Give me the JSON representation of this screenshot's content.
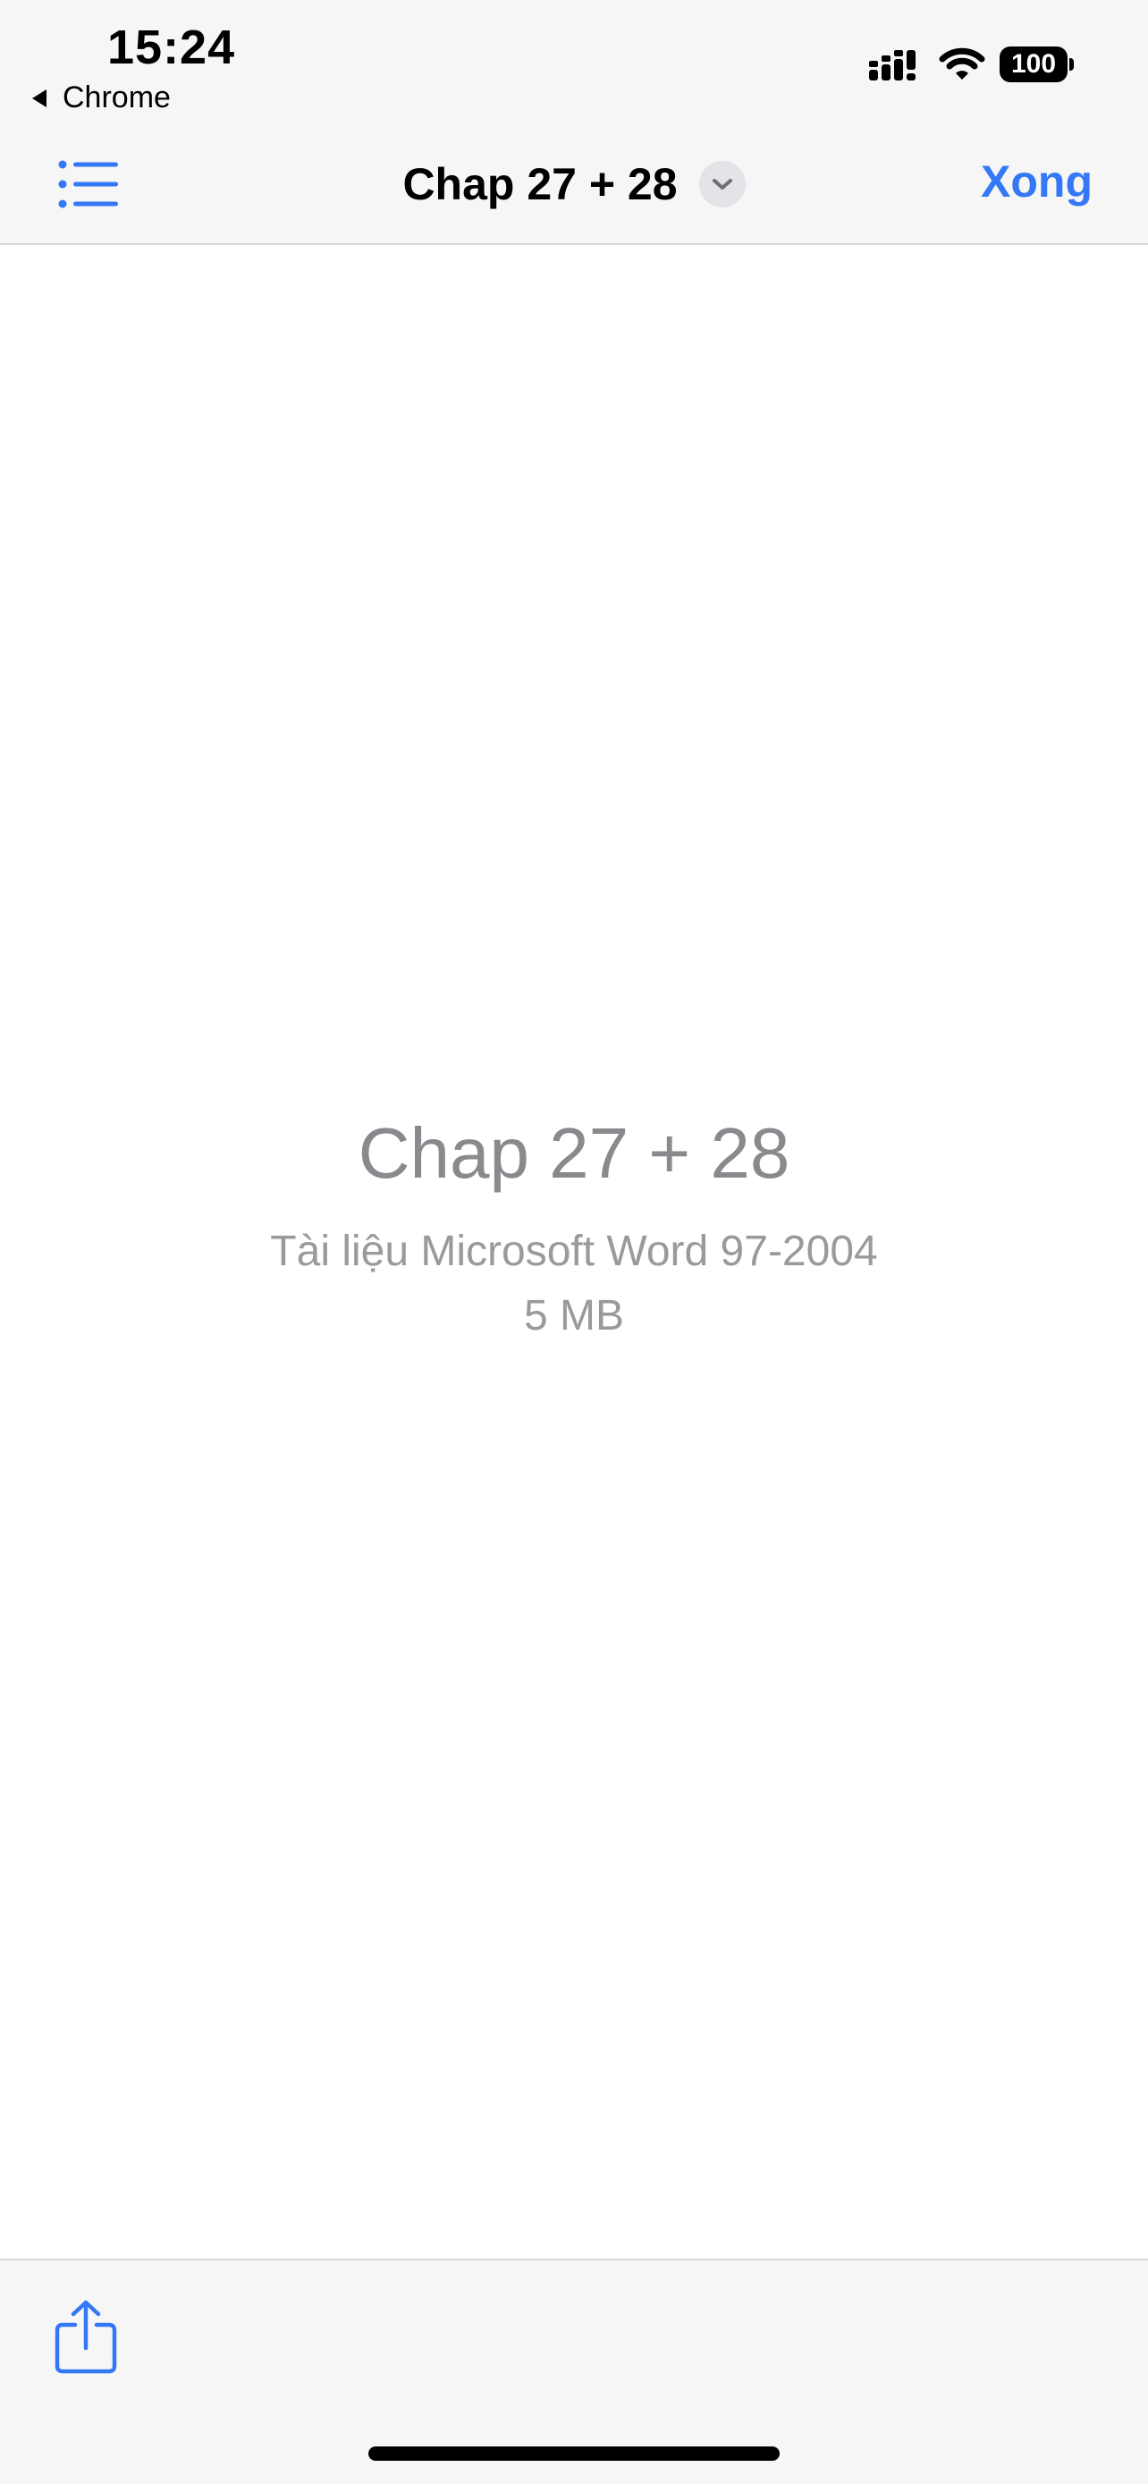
{
  "status_bar": {
    "time": "15:24",
    "back_app": "Chrome",
    "battery": "100"
  },
  "nav_bar": {
    "title": "Chap 27 + 28",
    "done_label": "Xong",
    "list_icon": "list-icon",
    "chevron_icon": "chevron-down-icon"
  },
  "document": {
    "title": "Chap 27 + 28",
    "type": "Tài liệu Microsoft Word 97-2004",
    "size": "5 MB"
  },
  "toolbar": {
    "share_icon": "share-icon"
  },
  "colors": {
    "accent": "#3478f6",
    "bar_background": "#f6f6f6",
    "secondary_text": "#8e8e93"
  }
}
